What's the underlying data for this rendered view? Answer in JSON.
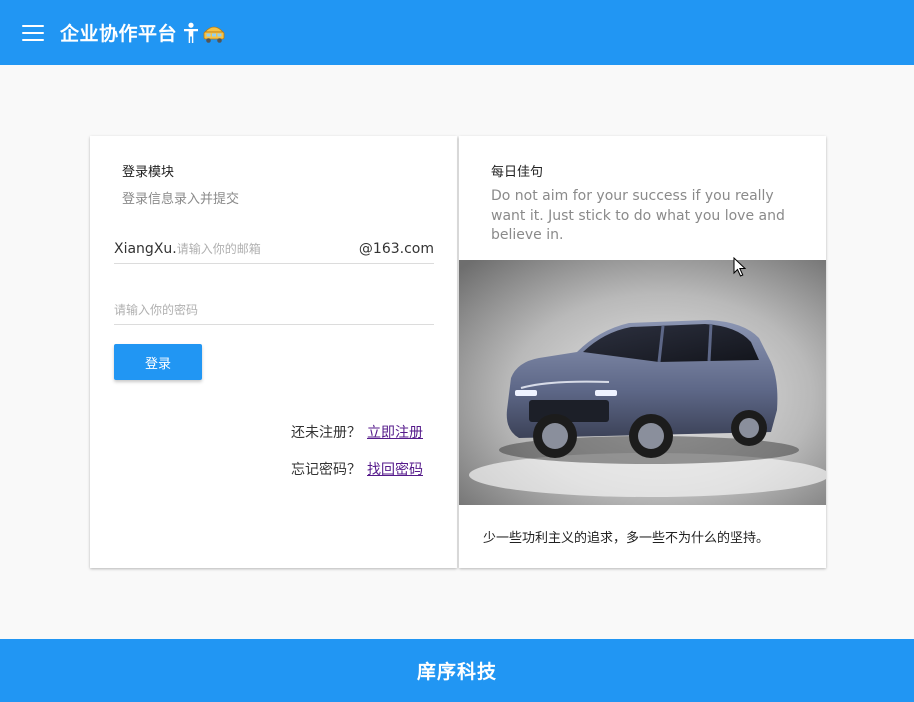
{
  "header": {
    "title": "企业协作平台",
    "menu_icon": "hamburger-menu-icon",
    "emoji_icons": [
      "person-standing-icon",
      "vehicle-icon"
    ]
  },
  "login_card": {
    "title": "登录模块",
    "subtitle": "登录信息录入并提交",
    "email_field": {
      "prefix": "XiangXu.",
      "placeholder": "请输入你的邮箱",
      "suffix": "@163.com",
      "value": ""
    },
    "password_field": {
      "placeholder": "请输入你的密码",
      "value": ""
    },
    "login_button": "登录",
    "register_prompt": "还未注册？",
    "register_link": "立即注册",
    "forgot_prompt": "忘记密码？",
    "forgot_link": "找回密码"
  },
  "quote_card": {
    "title": "每日佳句",
    "quote_en": "Do not aim for your success if you really want it. Just stick to do what you love and believe in.",
    "quote_cn": "少一些功利主义的追求，多一些不为什么的坚持。"
  },
  "footer": {
    "text": "庠序科技"
  },
  "colors": {
    "primary": "#2196f3",
    "background": "#f9f9f9",
    "link": "#551a8b"
  }
}
